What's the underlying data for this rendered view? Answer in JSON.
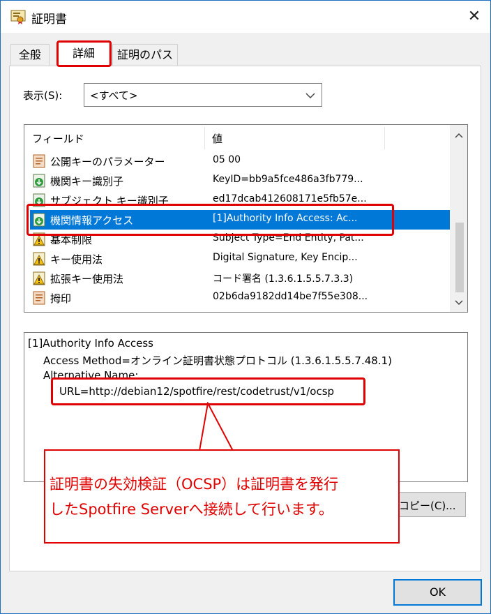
{
  "window": {
    "title": "証明書",
    "close_glyph": "✕"
  },
  "tabs": [
    {
      "label": "全般"
    },
    {
      "label": "詳細"
    },
    {
      "label": "証明のパス"
    }
  ],
  "show": {
    "label": "表示(S):",
    "value": "<すべて>"
  },
  "list": {
    "headers": {
      "field": "フィールド",
      "value": "値"
    },
    "rows": [
      {
        "field": "公開キーのパラメーター",
        "value": "05 00",
        "icon": "certificate-field-icon"
      },
      {
        "field": "機関キー識別子",
        "value": "KeyID=bb9a5fce486a3fb779...",
        "icon": "certificate-extension-icon"
      },
      {
        "field": "サブジェクト キー識別子",
        "value": "ed17dcab412608171e5fb57e...",
        "icon": "certificate-extension-icon"
      },
      {
        "field": "機関情報アクセス",
        "value": "[1]Authority Info Access: Ac...",
        "icon": "certificate-extension-icon"
      },
      {
        "field": "基本制限",
        "value": "Subject Type=End Entity, Pat...",
        "icon": "critical-extension-icon"
      },
      {
        "field": "キー使用法",
        "value": "Digital Signature, Key Encip...",
        "icon": "critical-extension-icon"
      },
      {
        "field": "拡張キー使用法",
        "value": "コード署名 (1.3.6.1.5.5.7.3.3)",
        "icon": "critical-extension-icon"
      },
      {
        "field": "拇印",
        "value": "02b6da9182dd14be7f55e308...",
        "icon": "certificate-field-icon"
      }
    ]
  },
  "detail": {
    "lines": [
      "[1]Authority Info Access",
      "Access Method=オンライン証明書状態プロトコル (1.3.6.1.5.5.7.48.1)",
      "Alternative Name:",
      "URL=http://debian12/spotfire/rest/codetrust/v1/ocsp"
    ]
  },
  "buttons": {
    "copy": "コピー(C)...",
    "ok": "OK"
  },
  "annotation": {
    "line1": "証明書の失効検証（OCSP）は証明書を発行",
    "line2": "したSpotfire  Serverへ接続して行います。",
    "color": "#e00000"
  }
}
